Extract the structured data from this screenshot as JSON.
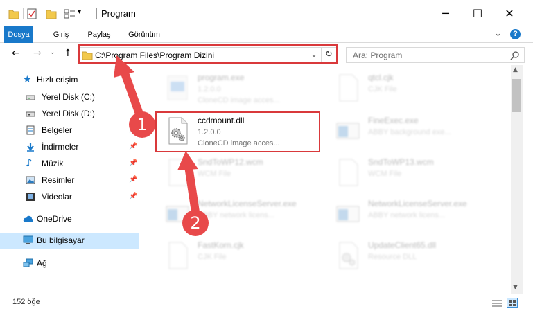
{
  "window": {
    "title": "Program",
    "minimize_glyph": "─",
    "maximize_glyph": "☐",
    "close_glyph": "✕"
  },
  "ribbon": {
    "tabs": [
      "Dosya",
      "Giriş",
      "Paylaş",
      "Görünüm"
    ],
    "expand_glyph": "⌄",
    "help_glyph": "?"
  },
  "address_bar": {
    "path": "C:\\Program Files\\Program Dizini",
    "dropdown_glyph": "⌄",
    "refresh_glyph": "↻"
  },
  "search": {
    "placeholder": "Ara: Program"
  },
  "nav_pane": {
    "quick_access": "Hızlı erişim",
    "items": [
      {
        "label": "Yerel Disk (C:)",
        "icon": "drive-icon",
        "pinned": false
      },
      {
        "label": "Yerel Disk (D:)",
        "icon": "drive-icon",
        "pinned": false
      },
      {
        "label": "Belgeler",
        "icon": "documents-icon",
        "pinned": true
      },
      {
        "label": "İndirmeler",
        "icon": "download-icon",
        "pinned": true
      },
      {
        "label": "Müzik",
        "icon": "music-icon",
        "pinned": true
      },
      {
        "label": "Resimler",
        "icon": "pictures-icon",
        "pinned": true
      },
      {
        "label": "Videolar",
        "icon": "video-icon",
        "pinned": true
      }
    ],
    "onedrive": "OneDrive",
    "this_pc": "Bu bilgisayar",
    "network": "Ağ"
  },
  "files": [
    {
      "name": "program.exe",
      "line1": "1.2.0.0",
      "line2": "CloneCD image acces...",
      "icon": "exe-icon",
      "highlighted": false
    },
    {
      "name": "qtcl.cjk",
      "line1": "CJK File",
      "line2": "",
      "icon": "blank-file-icon",
      "highlighted": false
    },
    {
      "name": "ccdmount.dll",
      "line1": "1.2.0.0",
      "line2": "CloneCD image acces...",
      "icon": "dll-gear-icon",
      "highlighted": true
    },
    {
      "name": "FineExec.exe",
      "line1": "ABBY background exe...",
      "line2": "",
      "icon": "app-window-icon",
      "highlighted": false
    },
    {
      "name": "SndToWP12.wcm",
      "line1": "WCM File",
      "line2": "",
      "icon": "blank-file-icon",
      "highlighted": false
    },
    {
      "name": "SndToWP13.wcm",
      "line1": "WCM File",
      "line2": "",
      "icon": "blank-file-icon",
      "highlighted": false
    },
    {
      "name": "NetworkLicenseServer.exe",
      "line1": "ABBY network licens...",
      "line2": "",
      "icon": "app-window-icon",
      "highlighted": false
    },
    {
      "name": "NetworkLicenseServer.exe",
      "line1": "ABBY network licens...",
      "line2": "",
      "icon": "app-window-icon",
      "highlighted": false
    },
    {
      "name": "FastKorn.cjk",
      "line1": "CJK File",
      "line2": "",
      "icon": "blank-file-icon",
      "highlighted": false
    },
    {
      "name": "UpdateClient65.dll",
      "line1": "Resource DLL",
      "line2": "",
      "icon": "dll-gear-icon",
      "highlighted": false
    }
  ],
  "status": {
    "count": "152 öğe"
  },
  "annotations": {
    "step1": "1",
    "step2": "2",
    "color": "#e8494a"
  }
}
